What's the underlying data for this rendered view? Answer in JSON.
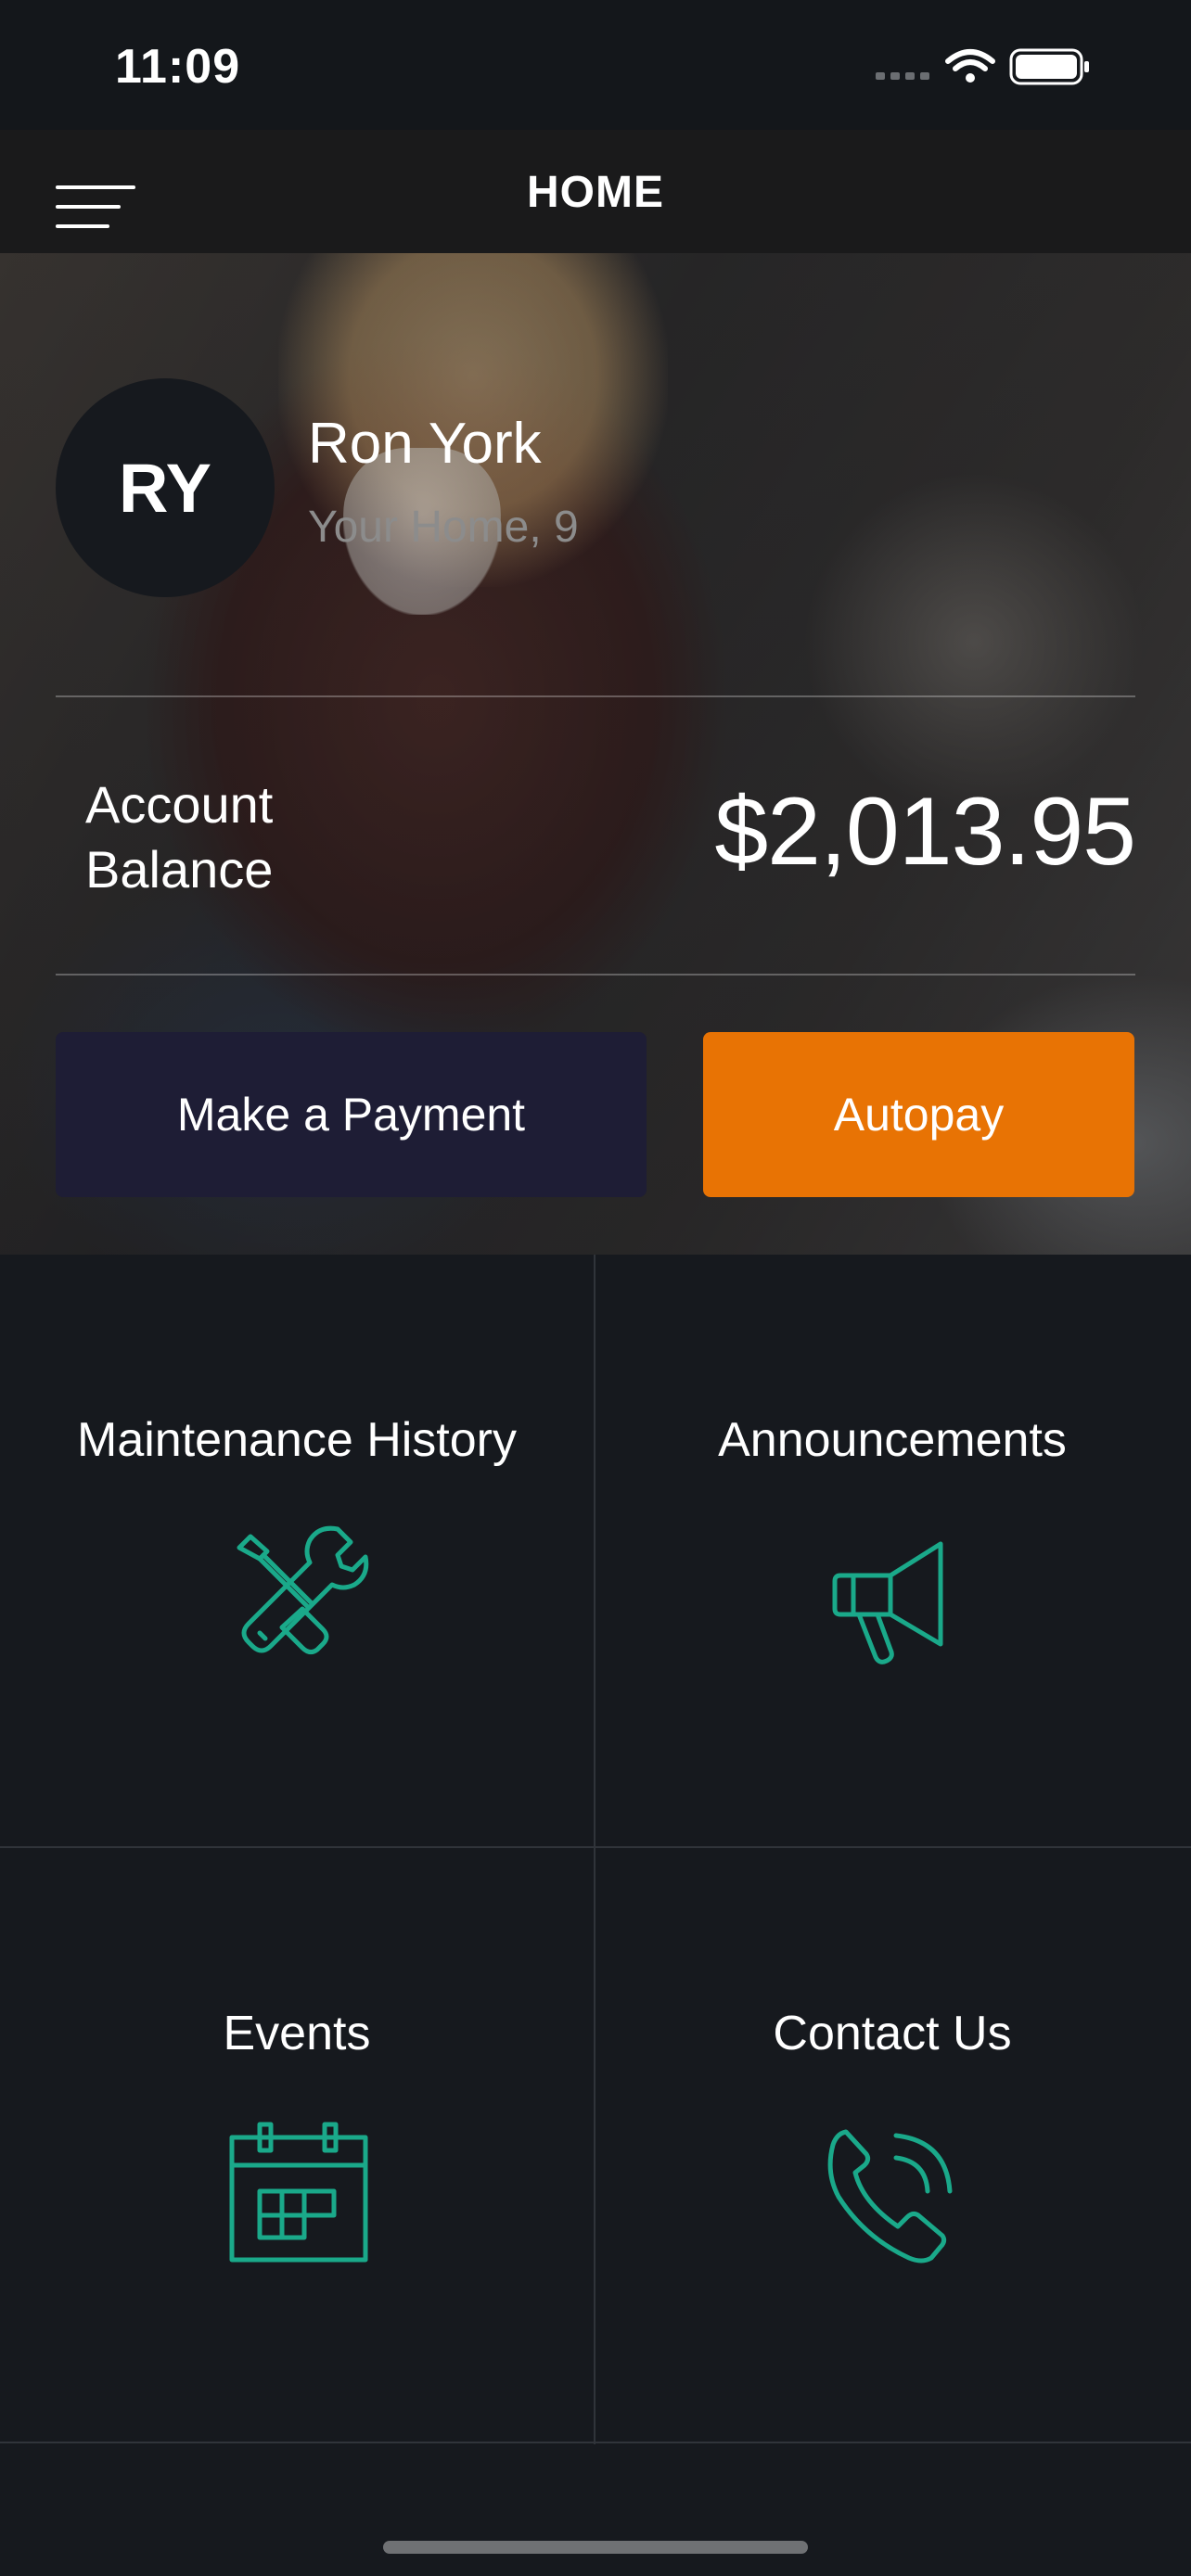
{
  "status_bar": {
    "time": "11:09"
  },
  "header": {
    "title": "HOME"
  },
  "profile": {
    "initials": "RY",
    "name": "Ron York",
    "address": "Your Home, 9"
  },
  "balance": {
    "label": "Account Balance",
    "amount": "$2,013.95"
  },
  "actions": {
    "make_payment": "Make a Payment",
    "autopay": "Autopay"
  },
  "tiles": [
    {
      "label": "Maintenance History",
      "icon": "wrench-screwdriver-icon"
    },
    {
      "label": "Announcements",
      "icon": "megaphone-icon"
    },
    {
      "label": "Events",
      "icon": "calendar-icon"
    },
    {
      "label": "Contact Us",
      "icon": "phone-icon"
    }
  ],
  "colors": {
    "accent": "#1aa98a",
    "autopay": "#e87304",
    "payment": "#1e1d35",
    "background": "#16191e"
  }
}
